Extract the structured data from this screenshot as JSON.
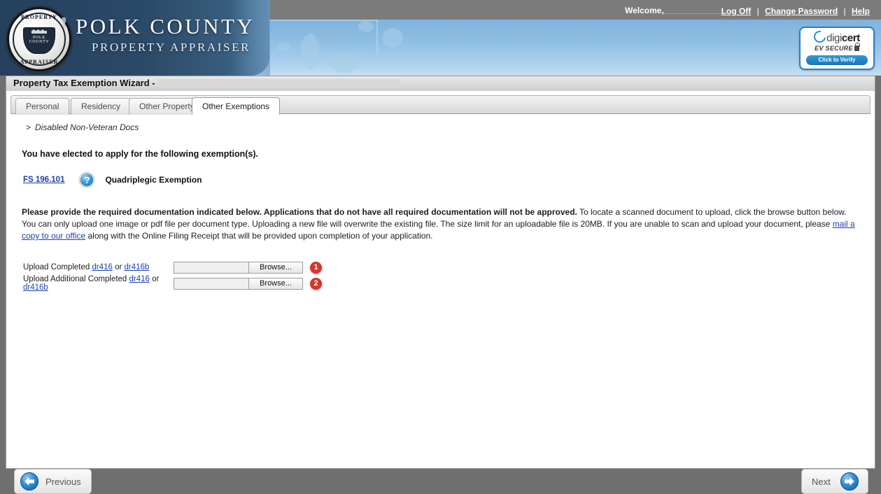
{
  "header": {
    "welcome_label": "Welcome,",
    "welcome_value_redacted": "",
    "links": [
      {
        "label": "Log Off",
        "name": "log-off-link"
      },
      {
        "label": "Change Password",
        "name": "change-password-link"
      },
      {
        "label": "Help",
        "name": "help-link"
      }
    ],
    "separator": "|",
    "org_title": "POLK COUNTY",
    "org_subtitle": "PROPERTY APPRAISER",
    "seal": {
      "top_text": "PROPERTY",
      "bottom_text": "APPRAISER",
      "shield_line1": "POLK",
      "shield_line2": "COUNTY"
    },
    "digicert": {
      "brand_light": "digi",
      "brand_bold": "cert",
      "tagline": "EV SECURE",
      "button": "Click to Verify"
    }
  },
  "wizard": {
    "title": "Property Tax Exemption Wizard -",
    "tabs": [
      {
        "label": "Personal",
        "active": false
      },
      {
        "label": "Residency",
        "active": false
      },
      {
        "label": "Other Property",
        "active": false
      },
      {
        "label": "Other Exemptions",
        "active": true
      }
    ],
    "breadcrumb_arrow": ">",
    "breadcrumb": "Disabled Non-Veteran Docs",
    "elected_heading": "You have elected to apply for the following exemption(s).",
    "exemption": {
      "statute_link": "FS 196.101",
      "help_icon_glyph": "?",
      "name": "Quadriplegic Exemption"
    },
    "instructions": {
      "bold_part": "Please provide the required documentation indicated below. Applications that do not have all required documentation will not be approved.",
      "rest_part_1": " To locate a scanned document to upload, click the browse button below. You can only upload one image or pdf file per document type. Uploading a new file will overwrite the existing file. The size limit for an uploadable file is 20MB. If you are unable to scan and upload your document, please ",
      "mail_link": "mail a copy to our office",
      "rest_part_2": " along with the Online Filing Receipt that will be provided upon completion of your application."
    },
    "uploads": [
      {
        "label_prefix": "Upload Completed ",
        "link_a": "dr416",
        "conjunction": " or ",
        "link_b": "dr416b",
        "value": "",
        "placeholder": "",
        "browse_label": "Browse...",
        "badge": "1"
      },
      {
        "label_prefix": "Upload Additional Completed ",
        "link_a": "dr416",
        "conjunction": " or ",
        "link_b": "dr416b",
        "value": "",
        "placeholder": "",
        "browse_label": "Browse...",
        "badge": "2"
      }
    ],
    "nav": {
      "previous_label": "Previous",
      "next_label": "Next"
    }
  },
  "colors": {
    "accent_blue": "#2f8ed6",
    "link_blue": "#1b3fae",
    "badge_red": "#d9342b",
    "header_navy": "#25405c",
    "header_sky": "#8fbfe4",
    "chrome_gray": "#7b7b7b"
  }
}
